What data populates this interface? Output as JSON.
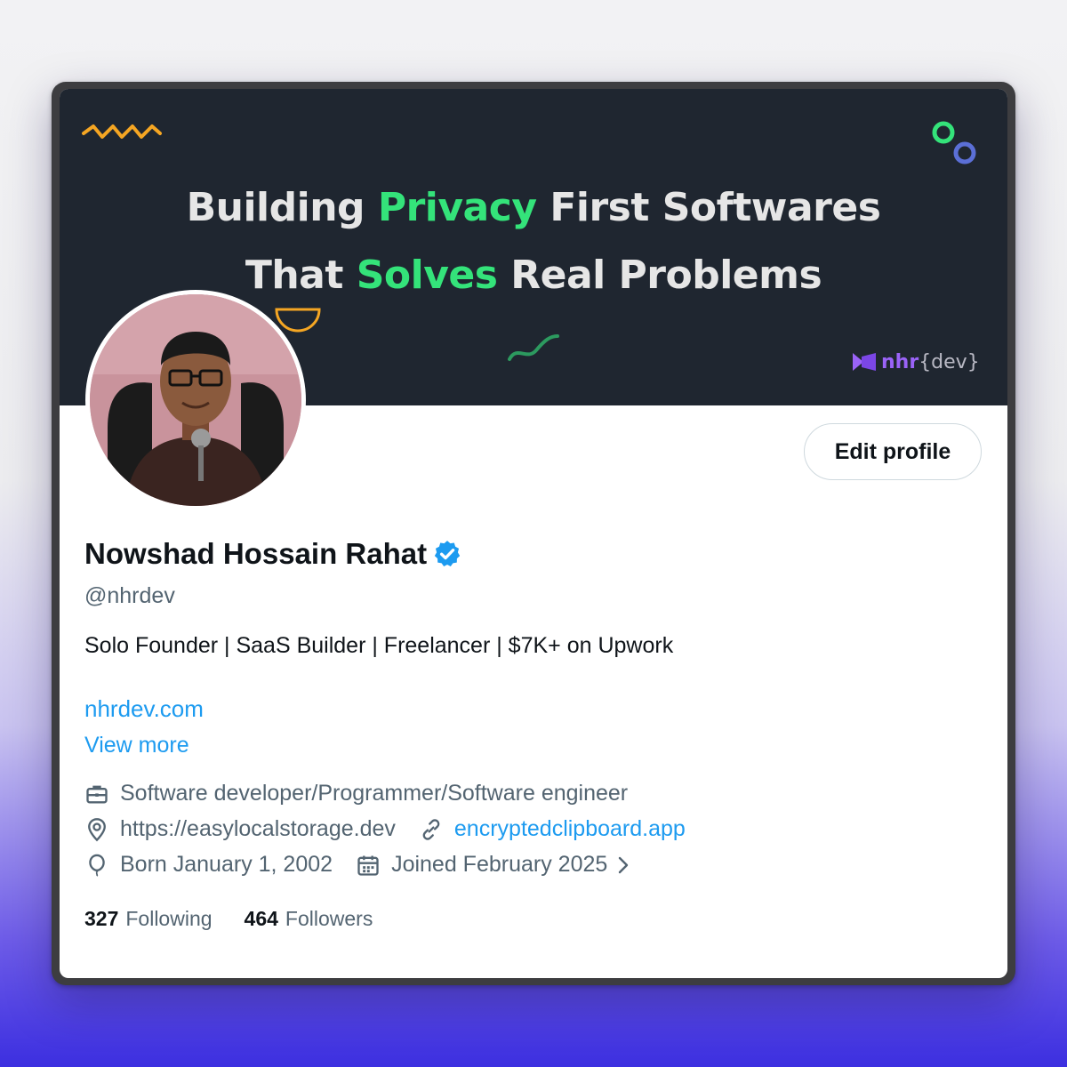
{
  "banner": {
    "line1_a": "Building ",
    "line1_hl": "Privacy",
    "line1_b": " First Softwares",
    "line2_a": "That ",
    "line2_hl": "Solves",
    "line2_b": " Real Problems",
    "brand_name": "nhr",
    "brand_suffix": "{dev}",
    "accent": "#34e37a",
    "brand_color": "#9a63f7"
  },
  "profile": {
    "name": "Nowshad Hossain Rahat",
    "handle": "@nhrdev",
    "bio": "Solo Founder | SaaS Builder | Freelancer | $7K+ on Upwork",
    "website": "nhrdev.com",
    "view_more": "View more",
    "edit_button": "Edit profile"
  },
  "meta": {
    "profession": "Software developer/Programmer/Software engineer",
    "location": "https://easylocalstorage.dev",
    "link": "encryptedclipboard.app",
    "born": "Born January 1, 2002",
    "joined": "Joined February 2025"
  },
  "stats": {
    "following_count": "327",
    "following_label": "Following",
    "followers_count": "464",
    "followers_label": "Followers"
  },
  "icons": [
    "briefcase-icon",
    "location-pin-icon",
    "link-icon",
    "balloon-icon",
    "calendar-icon",
    "chevron-right-icon",
    "verified-badge-icon"
  ]
}
